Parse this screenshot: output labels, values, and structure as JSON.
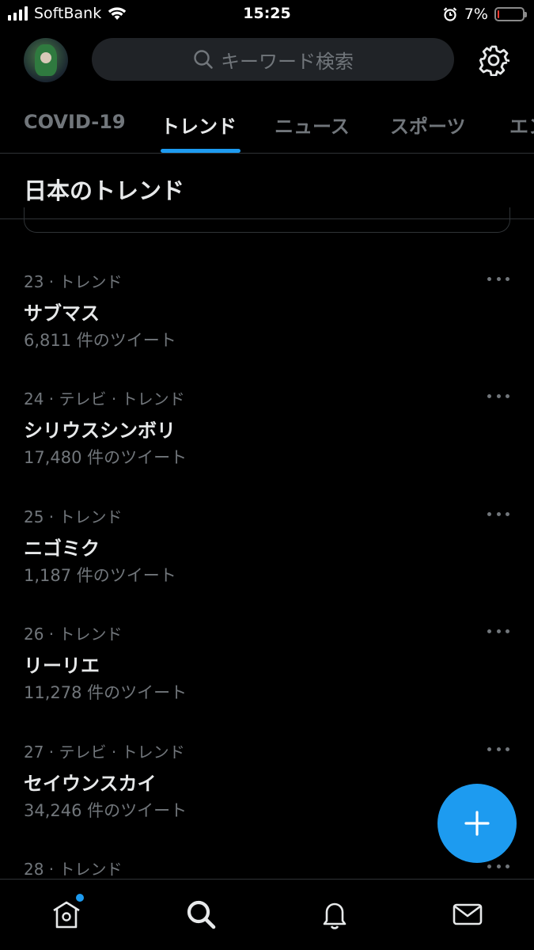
{
  "status_bar": {
    "carrier": "SoftBank",
    "time": "15:25",
    "battery_percent": "7%",
    "battery_level": 0.07,
    "battery_color": "#ff3b30"
  },
  "header": {
    "search_placeholder": "キーワード検索",
    "avatar_icon": "user-avatar",
    "settings_icon": "gear-icon"
  },
  "tabs": [
    {
      "label": "COVID-19",
      "active": false
    },
    {
      "label": "トレンド",
      "active": true
    },
    {
      "label": "ニュース",
      "active": false
    },
    {
      "label": "スポーツ",
      "active": false
    },
    {
      "label": "エン",
      "active": false
    }
  ],
  "section_title": "日本のトレンド",
  "trends": [
    {
      "meta": "23 · トレンド",
      "name": "サブマス",
      "count": "6,811 件のツイート"
    },
    {
      "meta": "24 · テレビ · トレンド",
      "name": "シリウスシンボリ",
      "count": "17,480 件のツイート"
    },
    {
      "meta": "25 · トレンド",
      "name": "ニゴミク",
      "count": "1,187 件のツイート"
    },
    {
      "meta": "26 · トレンド",
      "name": "リーリエ",
      "count": "11,278 件のツイート"
    },
    {
      "meta": "27 · テレビ · トレンド",
      "name": "セイウンスカイ",
      "count": "34,246 件のツイート"
    },
    {
      "meta": "28 · トレンド",
      "name": "",
      "count": ""
    }
  ],
  "fab": {
    "label": "+",
    "icon": "compose-plus-icon"
  },
  "bottom_nav": [
    {
      "icon": "home-icon",
      "has_badge": true
    },
    {
      "icon": "search-icon",
      "active": true
    },
    {
      "icon": "bell-icon"
    },
    {
      "icon": "mail-icon"
    }
  ],
  "colors": {
    "background": "#000000",
    "accent": "#1d9bf0",
    "primary_text": "#e7e9ea",
    "secondary_text": "#71767b",
    "divider": "#2f3336",
    "search_bg": "#202327"
  }
}
